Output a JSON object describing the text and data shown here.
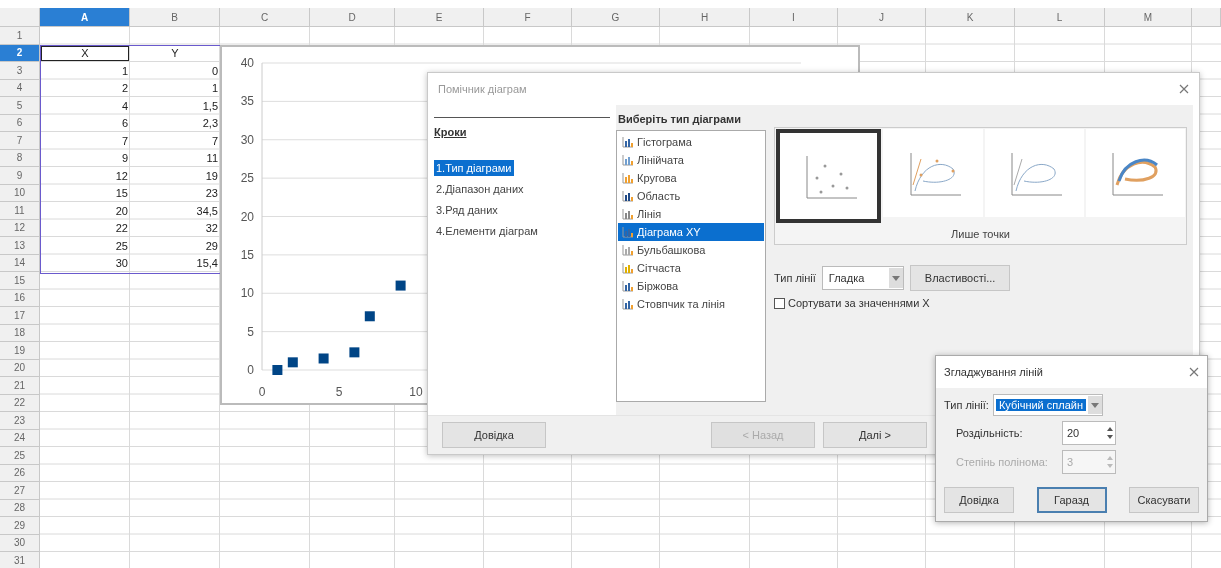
{
  "sheet": {
    "columns": [
      {
        "label": "A",
        "selected": true
      },
      {
        "label": "B",
        "selected": false
      },
      {
        "label": "C",
        "selected": false
      },
      {
        "label": "D",
        "selected": false
      },
      {
        "label": "E",
        "selected": false
      },
      {
        "label": "F",
        "selected": false
      },
      {
        "label": "G",
        "selected": false
      },
      {
        "label": "H",
        "selected": false
      },
      {
        "label": "I",
        "selected": false
      },
      {
        "label": "J",
        "selected": false
      },
      {
        "label": "K",
        "selected": false
      },
      {
        "label": "L",
        "selected": false
      },
      {
        "label": "M",
        "selected": false
      }
    ],
    "rows": [
      {
        "label": "1",
        "selected": false
      },
      {
        "label": "2",
        "selected": true,
        "cells": [
          "X",
          "Y"
        ]
      },
      {
        "label": "3",
        "selected": false,
        "cells": [
          "1",
          "0"
        ]
      },
      {
        "label": "4",
        "selected": false,
        "cells": [
          "2",
          "1"
        ]
      },
      {
        "label": "5",
        "selected": false,
        "cells": [
          "4",
          "1,5"
        ]
      },
      {
        "label": "6",
        "selected": false,
        "cells": [
          "6",
          "2,3"
        ]
      },
      {
        "label": "7",
        "selected": false,
        "cells": [
          "7",
          "7"
        ]
      },
      {
        "label": "8",
        "selected": false,
        "cells": [
          "9",
          "11"
        ]
      },
      {
        "label": "9",
        "selected": false,
        "cells": [
          "12",
          "19"
        ]
      },
      {
        "label": "10",
        "selected": false,
        "cells": [
          "15",
          "23"
        ]
      },
      {
        "label": "11",
        "selected": false,
        "cells": [
          "20",
          "34,5"
        ]
      },
      {
        "label": "12",
        "selected": false,
        "cells": [
          "22",
          "32"
        ]
      },
      {
        "label": "13",
        "selected": false,
        "cells": [
          "25",
          "29"
        ]
      },
      {
        "label": "14",
        "selected": false,
        "cells": [
          "30",
          "15,4"
        ]
      },
      {
        "label": "15",
        "selected": false
      },
      {
        "label": "16",
        "selected": false
      },
      {
        "label": "17",
        "selected": false
      },
      {
        "label": "18",
        "selected": false
      },
      {
        "label": "19",
        "selected": false
      },
      {
        "label": "20",
        "selected": false
      },
      {
        "label": "21",
        "selected": false
      },
      {
        "label": "22",
        "selected": false
      },
      {
        "label": "23",
        "selected": false
      },
      {
        "label": "24",
        "selected": false
      },
      {
        "label": "25",
        "selected": false
      },
      {
        "label": "26",
        "selected": false
      },
      {
        "label": "27",
        "selected": false
      },
      {
        "label": "28",
        "selected": false
      },
      {
        "label": "29",
        "selected": false
      },
      {
        "label": "30",
        "selected": false
      },
      {
        "label": "31",
        "selected": false
      }
    ]
  },
  "chart": {
    "chart_data": {
      "type": "scatter",
      "x": [
        1,
        2,
        4,
        6,
        7,
        9
      ],
      "grid": true,
      "series": [
        {
          "color": "#004586",
          "values": [
            0,
            1,
            1.5,
            2.3,
            7,
            11
          ]
        }
      ],
      "xlim": [
        0,
        35
      ],
      "ylim": [
        0,
        40
      ],
      "xticks": [
        0,
        5,
        10
      ],
      "yticks": [
        0,
        5,
        10,
        15,
        20,
        25,
        30,
        35,
        40
      ]
    }
  },
  "chart_wizard": {
    "title": "Помічник діаграм",
    "active": false,
    "steps_heading": "Кроки",
    "steps": [
      {
        "label": "1.Тип діаграми",
        "selected": true
      },
      {
        "label": "2.Діапазон даних",
        "selected": false
      },
      {
        "label": "3.Ряд даних",
        "selected": false
      },
      {
        "label": "4.Елементи діаграм",
        "selected": false
      }
    ],
    "chart_types_heading": "Виберіть тип діаграми",
    "chart_types": [
      {
        "label": "Гістограма",
        "selected": false
      },
      {
        "label": "Лінійчата",
        "selected": false
      },
      {
        "label": "Кругова",
        "selected": false
      },
      {
        "label": "Область",
        "selected": false
      },
      {
        "label": "Лінія",
        "selected": false
      },
      {
        "label": "Діаграма XY",
        "selected": true
      },
      {
        "label": "Бульбашкова",
        "selected": false
      },
      {
        "label": "Сітчаста",
        "selected": false
      },
      {
        "label": "Біржова",
        "selected": false
      },
      {
        "label": "Стовпчик та лінія",
        "selected": false
      }
    ],
    "variants": [
      {
        "kind": "points",
        "selected": true
      },
      {
        "kind": "pointslines",
        "selected": false
      },
      {
        "kind": "lines",
        "selected": false
      },
      {
        "kind": "solid",
        "selected": false
      }
    ],
    "variant_caption": "Лише точки",
    "line_type_label": "Тип лінії",
    "line_type": "Гладка",
    "properties_button": "Властивості...",
    "sort_checkbox": {
      "label": "Сортувати за значеннями X",
      "checked": false
    },
    "buttons": [
      {
        "label": "Довідка",
        "disabled": false
      },
      {
        "label": "< Назад",
        "disabled": true
      },
      {
        "label": "Далі >",
        "disabled": false
      }
    ]
  },
  "smoothing_dialog": {
    "title": "Згладжування ліній",
    "line_type_label": "Тип лінії:",
    "line_type": {
      "value": "Кубічний сплайн",
      "focused": true
    },
    "fields": [
      {
        "label": "Роздільність:",
        "value": "20",
        "disabled": false
      },
      {
        "label": "Степінь полінома:",
        "value": "3",
        "disabled": true
      }
    ],
    "buttons": [
      {
        "label": "Довідка",
        "default": false
      },
      {
        "label": "Гаразд",
        "default": true
      },
      {
        "label": "Скасувати",
        "default": false
      }
    ]
  }
}
